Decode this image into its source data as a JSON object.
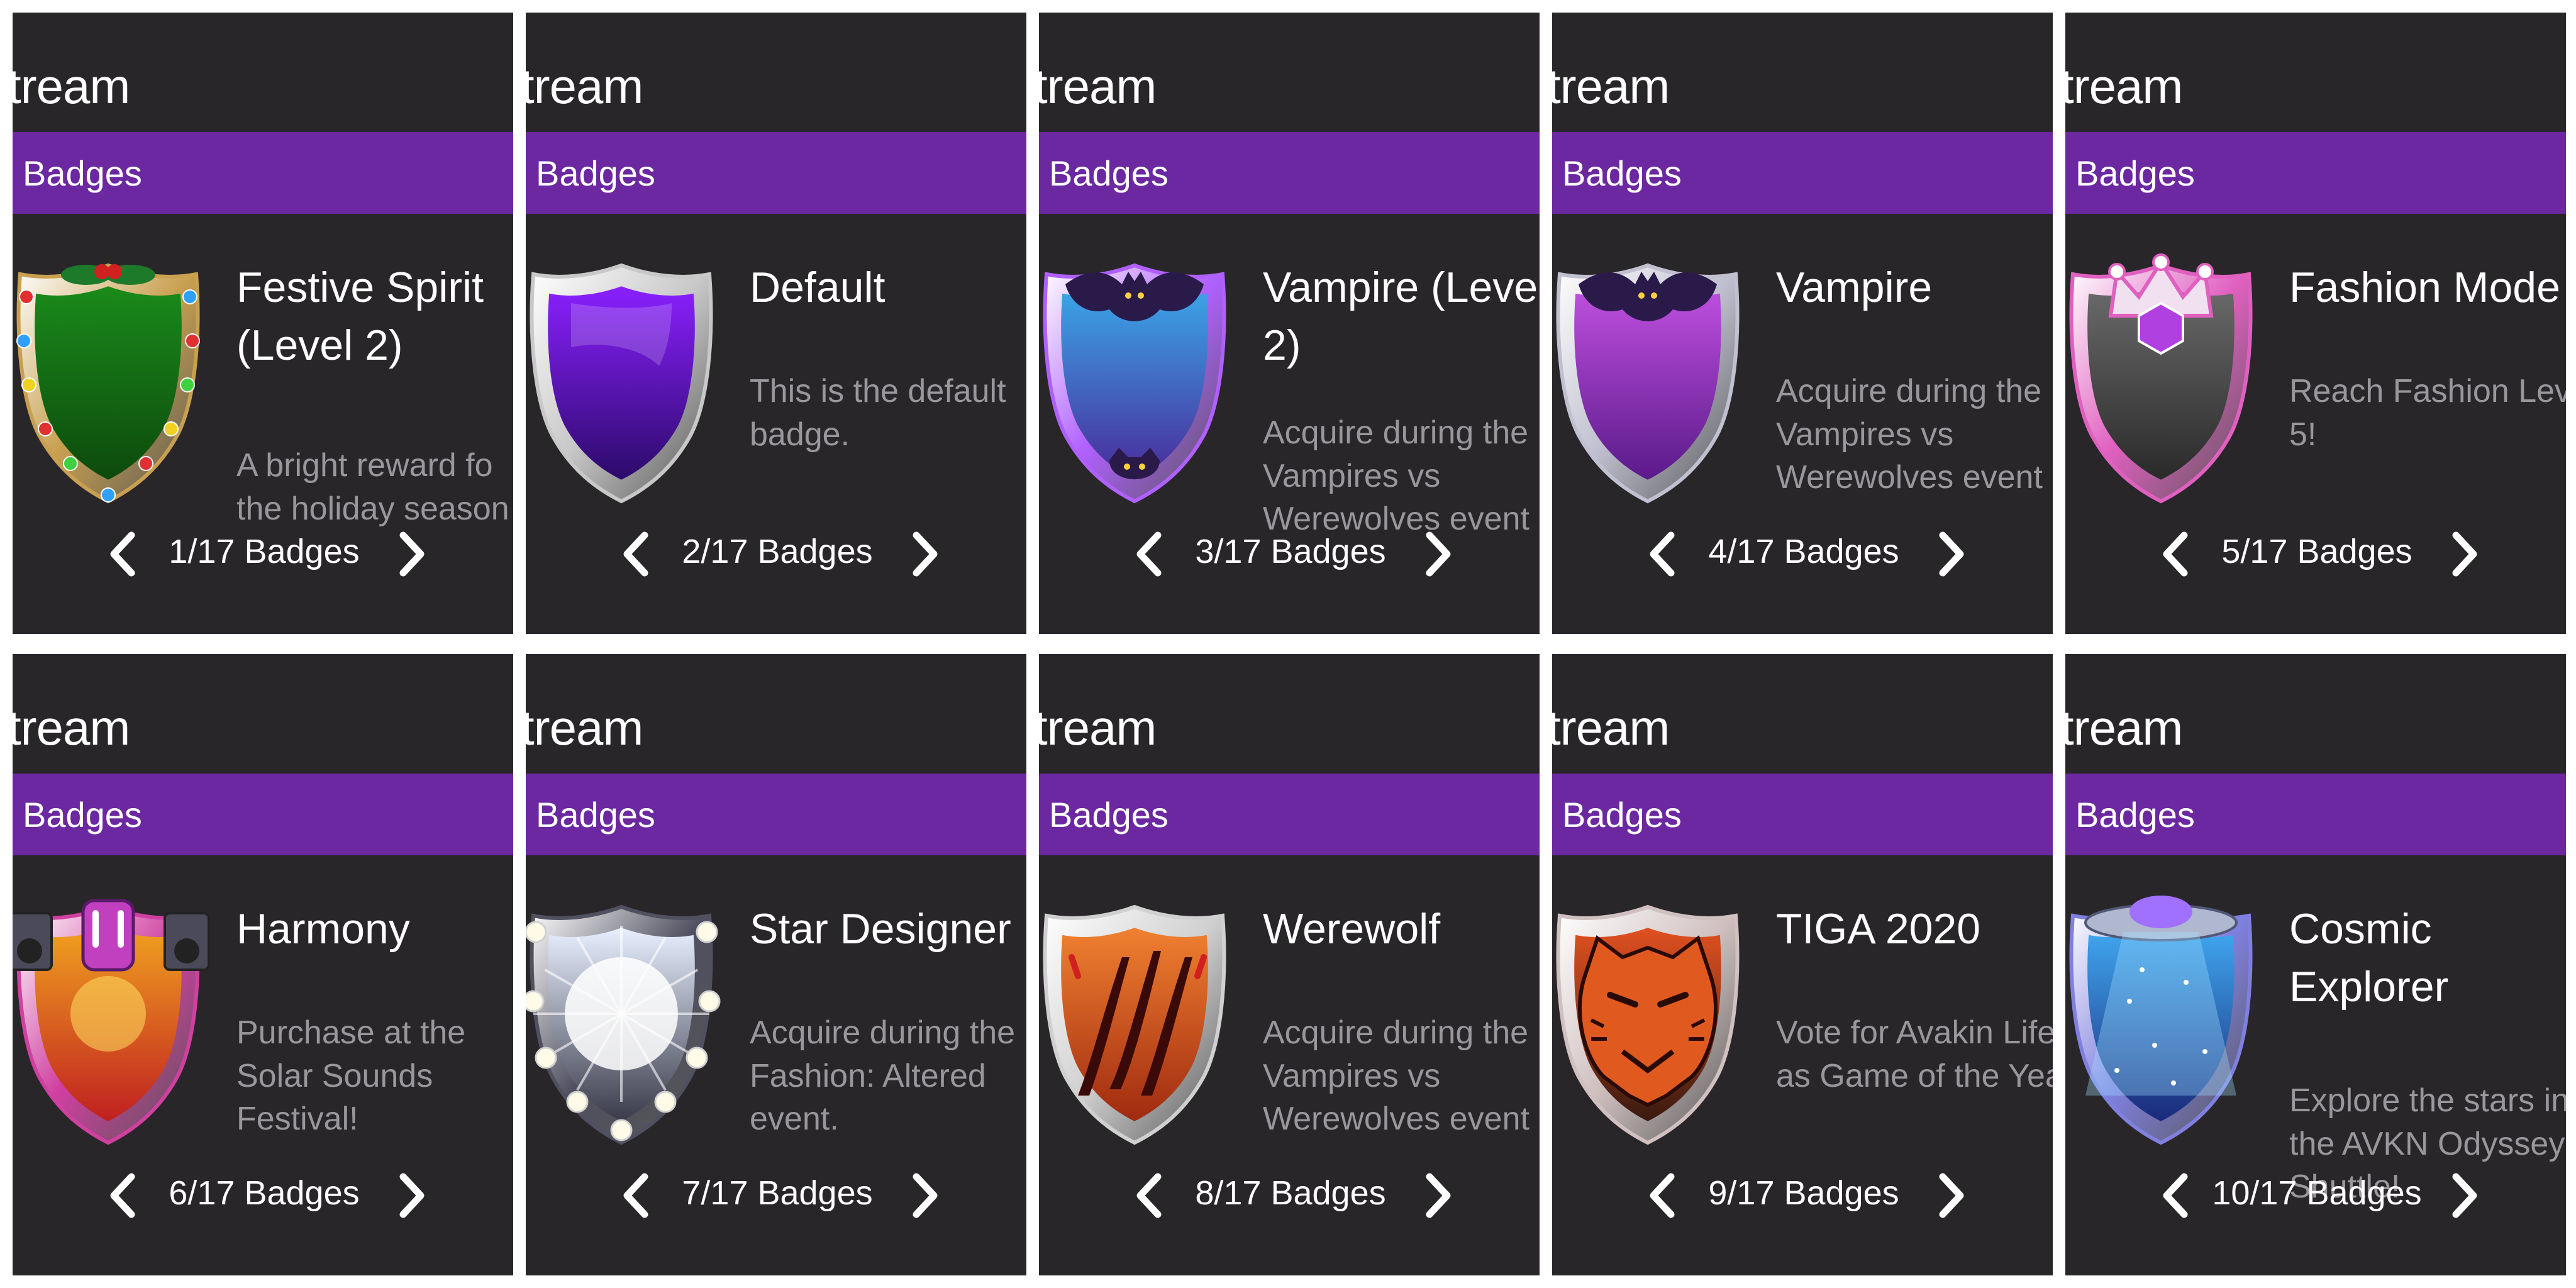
{
  "tiles": [
    {
      "app_title": "tream",
      "section": "Badges",
      "badge_name": "Festive Spirit\n(Level 2)",
      "badge_description": "A bright reward fo\nthe holiday season",
      "counter": "1/17 Badges",
      "icon": "festive-shield-icon",
      "colors": {
        "top": "#1a8a1a",
        "bottom": "#0d4a0d",
        "rim": "#c8a050"
      }
    },
    {
      "app_title": "tream",
      "section": "Badges",
      "badge_name": "Default",
      "badge_description": "This is the default\nbadge.",
      "counter": "2/17 Badges",
      "icon": "default-shield-icon",
      "colors": {
        "top": "#8a20ff",
        "bottom": "#2c0a6a",
        "rim": "#c8c8c8"
      }
    },
    {
      "app_title": "tream",
      "section": "Badges",
      "badge_name": "Vampire (Leve\n2)",
      "badge_description": "Acquire during the\nVampires vs\nWerewolves event",
      "counter": "3/17 Badges",
      "icon": "vampire-level2-shield-icon",
      "colors": {
        "top": "#3aa8e8",
        "bottom": "#4a2a9a",
        "rim": "#b060ff"
      }
    },
    {
      "app_title": "tream",
      "section": "Badges",
      "badge_name": "Vampire",
      "badge_description": "Acquire during the\nVampires vs\nWerewolves event",
      "counter": "4/17 Badges",
      "icon": "vampire-shield-icon",
      "colors": {
        "top": "#c050e0",
        "bottom": "#5a1a8a",
        "rim": "#c0c0d0"
      }
    },
    {
      "app_title": "tream",
      "section": "Badges",
      "badge_name": "Fashion Mode",
      "badge_description": "Reach Fashion Lev\n5!",
      "counter": "5/17 Badges",
      "icon": "fashion-model-shield-icon",
      "colors": {
        "top": "#6a6a6a",
        "bottom": "#2a2a2a",
        "rim": "#e060c0"
      }
    },
    {
      "app_title": "tream",
      "section": "Badges",
      "badge_name": "Harmony",
      "badge_description": "Purchase at the\nSolar Sounds\nFestival!",
      "counter": "6/17 Badges",
      "icon": "harmony-shield-icon",
      "colors": {
        "top": "#f0a020",
        "bottom": "#c02020",
        "rim": "#d040a0"
      }
    },
    {
      "app_title": "tream",
      "section": "Badges",
      "badge_name": "Star Designer",
      "badge_description": "Acquire during the\nFashion: Altered\nevent.",
      "counter": "7/17 Badges",
      "icon": "star-designer-shield-icon",
      "colors": {
        "top": "#e8f0ff",
        "bottom": "#3a3a4a",
        "rim": "#505060"
      }
    },
    {
      "app_title": "tream",
      "section": "Badges",
      "badge_name": "Werewolf",
      "badge_description": "Acquire during the\nVampires vs\nWerewolves event",
      "counter": "8/17 Badges",
      "icon": "werewolf-shield-icon",
      "colors": {
        "top": "#f08030",
        "bottom": "#a02a10",
        "rim": "#d0d0d0"
      }
    },
    {
      "app_title": "tream",
      "section": "Badges",
      "badge_name": "TIGA 2020",
      "badge_description": "Vote for Avakin Life\nas Game of the Yea",
      "counter": "9/17 Badges",
      "icon": "tiga-tiger-shield-icon",
      "colors": {
        "top": "#e05020",
        "bottom": "#3a1a10",
        "rim": "#d0c0c0"
      }
    },
    {
      "app_title": "tream",
      "section": "Badges",
      "badge_name": "Cosmic\nExplorer",
      "badge_description": "Explore the stars in\nthe AVKN Odyssey\nShuttle!",
      "counter": "10/17 Badges",
      "icon": "cosmic-explorer-shield-icon",
      "colors": {
        "top": "#40a8f0",
        "bottom": "#1a2a7a",
        "rim": "#8080e0"
      }
    }
  ]
}
